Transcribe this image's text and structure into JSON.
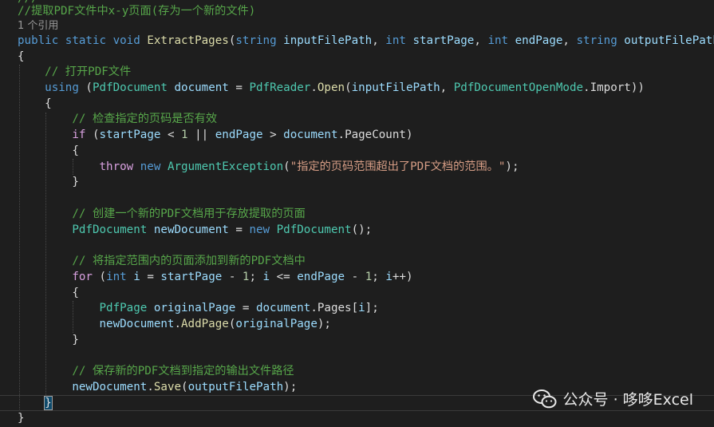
{
  "code": {
    "cut_line": "///",
    "summary_comment": "//提取PDF文件中x-y页面(存为一个新的文件)",
    "codelens": "1 个引用",
    "signature": {
      "mod1": "public",
      "mod2": "static",
      "ret": "void",
      "name": "ExtractPages",
      "t1": "string",
      "p1": "inputFilePath",
      "t2": "int",
      "p2": "startPage",
      "t3": "int",
      "p3": "endPage",
      "t4": "string",
      "p4": "outputFilePath"
    },
    "open_brace": "{",
    "close_brace": "}",
    "comment_open": "// 打开PDF文件",
    "using_kw": "using",
    "doc_type": "PdfDocument",
    "doc_var": "document",
    "reader": "PdfReader",
    "open_fn": "Open",
    "arg_path": "inputFilePath",
    "mode_type": "PdfDocumentOpenMode",
    "mode_val": "Import",
    "comment_check": "// 检查指定的页码是否有效",
    "if_kw": "if",
    "cond_start": "startPage",
    "one": "1",
    "cond_end": "endPage",
    "cond_doc": "document",
    "page_count": "PageCount",
    "throw_kw": "throw",
    "new_kw": "new",
    "exc_type": "ArgumentException",
    "exc_msg": "\"指定的页码范围超出了PDF文档的范围。\"",
    "comment_create": "// 创建一个新的PDF文档用于存放提取的页面",
    "new_doc_var": "newDocument",
    "comment_add": "// 将指定范围内的页面添加到新的PDF文档中",
    "for_kw": "for",
    "int_kw": "int",
    "i_var": "i",
    "page_type": "PdfPage",
    "orig_var": "originalPage",
    "pages_prop": "Pages",
    "add_fn": "AddPage",
    "comment_save": "// 保存新的PDF文档到指定的输出文件路径",
    "save_fn": "Save",
    "out_path": "outputFilePath"
  },
  "watermark": {
    "text": "公众号 · 哆哆Excel",
    "icon": "wechat-icon"
  }
}
